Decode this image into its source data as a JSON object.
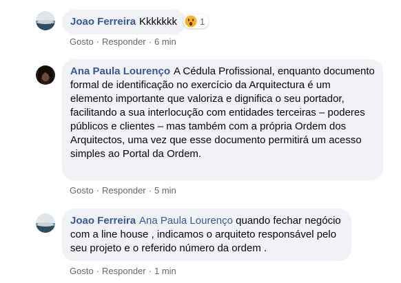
{
  "comments": [
    {
      "author": "Joao Ferreira",
      "mention": "",
      "text": "Kkkkkkk",
      "reaction_icon": "wow-emoji-icon",
      "reaction_count": "1",
      "like_label": "Gosto",
      "reply_label": "Responder",
      "time": "6 min"
    },
    {
      "author": "Ana Paula Lourenço",
      "mention": "",
      "text": "A Cédula Profissional, enquanto documento formal de identificação no exercício da Arquitectura é um elemento importante que valoriza e dignifica o seu portador, facilitando a sua interlocução com entidades terceiras – poderes públicos e clientes – mas também com a própria Ordem dos Arquitectos, uma vez que esse documento permitirá um acesso simples ao Portal da Ordem.",
      "like_label": "Gosto",
      "reply_label": "Responder",
      "time": "5 min"
    },
    {
      "author": "Joao Ferreira",
      "mention": "Ana Paula Lourenço",
      "text": "quando fechar negócio com a line house , indicamos o arquiteto responsável pelo seu projeto e o referido número da ordem .",
      "like_label": "Gosto",
      "reply_label": "Responder",
      "time": "1 min"
    }
  ],
  "separator": "·"
}
